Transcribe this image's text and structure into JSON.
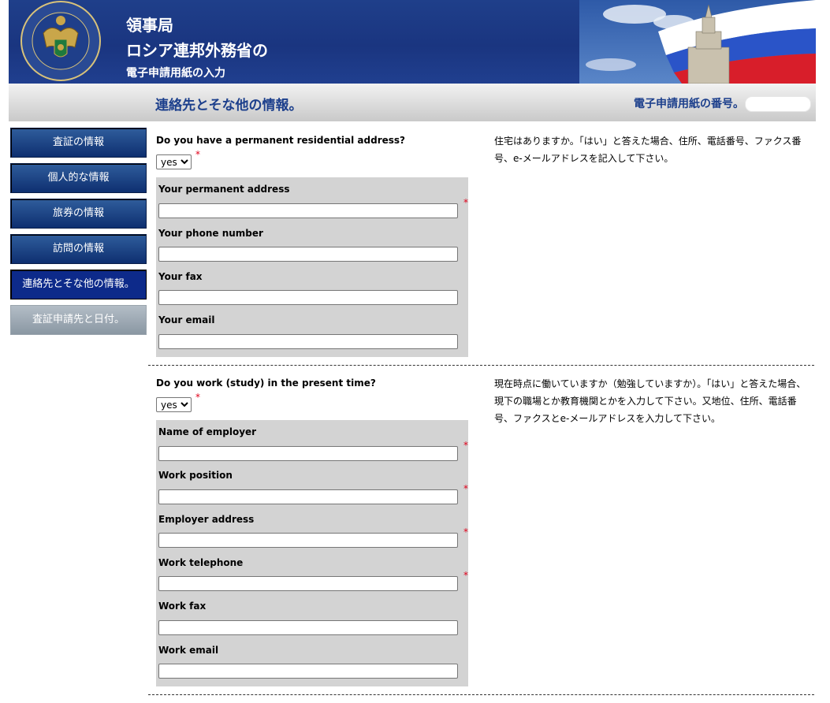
{
  "header": {
    "line1": "領事局",
    "line2": "ロシア連邦外務省の",
    "line3": "電子申請用紙の入力"
  },
  "titlebar": {
    "page_title": "連絡先とそな他の情報。",
    "app_number_label": "電子申請用紙の番号。",
    "app_number_value": ""
  },
  "sidebar": {
    "items": [
      {
        "label": "査証の情報"
      },
      {
        "label": "個人的な情報"
      },
      {
        "label": "旅券の情報"
      },
      {
        "label": "訪問の情報"
      },
      {
        "label": "連絡先とそな他の情報。",
        "state": "active"
      },
      {
        "label": "査証申請先と日付。",
        "state": "disabled"
      }
    ]
  },
  "residence": {
    "question": "Do you have a permanent residential address?",
    "answer": "yes",
    "required_mark": "*",
    "help": "住宅はありますか。「はい」と答えた場合、住所、電話番号、ファクス番号、e-メールアドレスを記入して下さい。",
    "fields": [
      {
        "label": "Your permanent address",
        "value": "",
        "required": true
      },
      {
        "label": "Your phone number",
        "value": "",
        "required": false
      },
      {
        "label": "Your fax",
        "value": "",
        "required": false
      },
      {
        "label": "Your email",
        "value": "",
        "required": false
      }
    ]
  },
  "work": {
    "question": "Do you work (study) in the present time?",
    "answer": "yes",
    "required_mark": "*",
    "help": "現在時点に働いていますか（勉強していますか）。「はい」と答えた場合、現下の職場とか教育機関とかを入力して下さい。又地位、住所、電話番号、ファクスとe-メールアドレスを入力して下さい。",
    "fields": [
      {
        "label": "Name of employer",
        "value": "",
        "required": true
      },
      {
        "label": "Work position",
        "value": "",
        "required": true
      },
      {
        "label": "Employer address",
        "value": "",
        "required": true
      },
      {
        "label": "Work telephone",
        "value": "",
        "required": true
      },
      {
        "label": "Work fax",
        "value": "",
        "required": false
      },
      {
        "label": "Work email",
        "value": "",
        "required": false
      }
    ]
  },
  "colors": {
    "header_blue": "#1f3f8a",
    "title_blue": "#1c3f8c",
    "nav_active": "#0d2a8a",
    "required_red": "#e0001a"
  }
}
